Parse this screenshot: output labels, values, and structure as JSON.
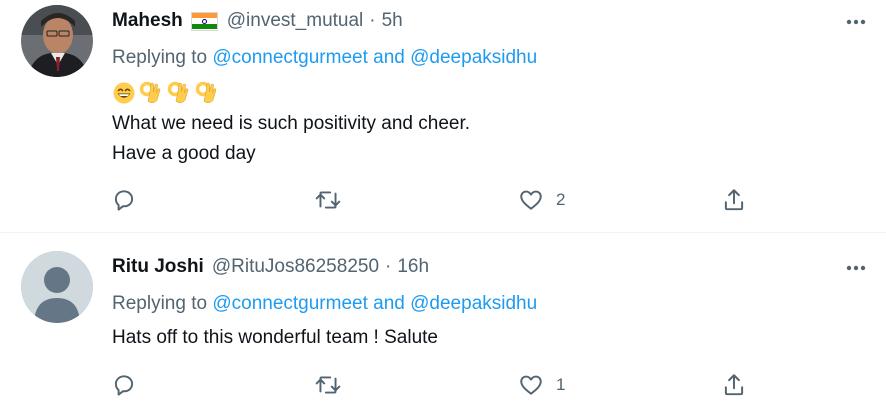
{
  "tweets": [
    {
      "name": "Mahesh",
      "handle": "@invest_mutual",
      "separator": "·",
      "time": "5h",
      "flag": "india-flag-emoji",
      "reply_prefix": "Replying to",
      "reply_users": "@connectgurmeet and @deepaksidhu",
      "emojis": [
        "grinning-face-emoji",
        "ok-hand-emoji",
        "ok-hand-emoji",
        "ok-hand-emoji"
      ],
      "text_lines": [
        "What we need is such positivity and cheer.",
        "Have a good day"
      ],
      "actions": {
        "reply_count": "",
        "retweet_count": "",
        "like_count": "2"
      }
    },
    {
      "name": "Ritu Joshi",
      "handle": "@RituJos86258250",
      "separator": "·",
      "time": "16h",
      "reply_prefix": "Replying to",
      "reply_users": "@connectgurmeet and @deepaksidhu",
      "text_lines": [
        "Hats off to this wonderful team ! Salute"
      ],
      "actions": {
        "reply_count": "",
        "retweet_count": "",
        "like_count": "1"
      }
    }
  ],
  "colors": {
    "text_primary": "#0f1419",
    "text_secondary": "#536471",
    "link": "#1d9bf0",
    "divider": "#eff3f4",
    "default_avatar": "#cfd9de"
  }
}
